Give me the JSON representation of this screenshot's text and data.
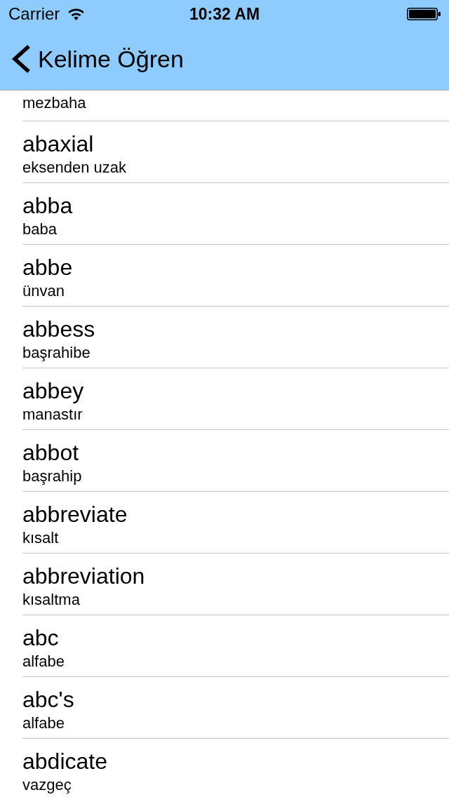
{
  "status_bar": {
    "carrier": "Carrier",
    "time": "10:32 AM"
  },
  "nav_bar": {
    "back_label": "Kelime Öğren"
  },
  "rows": [
    {
      "meaning": "mezbaha"
    },
    {
      "word": "abaxial",
      "meaning": "eksenden uzak"
    },
    {
      "word": "abba",
      "meaning": "baba"
    },
    {
      "word": "abbe",
      "meaning": "ünvan"
    },
    {
      "word": "abbess",
      "meaning": "başrahibe"
    },
    {
      "word": "abbey",
      "meaning": "manastır"
    },
    {
      "word": "abbot",
      "meaning": "başrahip"
    },
    {
      "word": "abbreviate",
      "meaning": "kısalt"
    },
    {
      "word": "abbreviation",
      "meaning": "kısaltma"
    },
    {
      "word": "abc",
      "meaning": "alfabe"
    },
    {
      "word": "abc's",
      "meaning": "alfabe"
    },
    {
      "word": "abdicate",
      "meaning": "vazgeç"
    }
  ]
}
